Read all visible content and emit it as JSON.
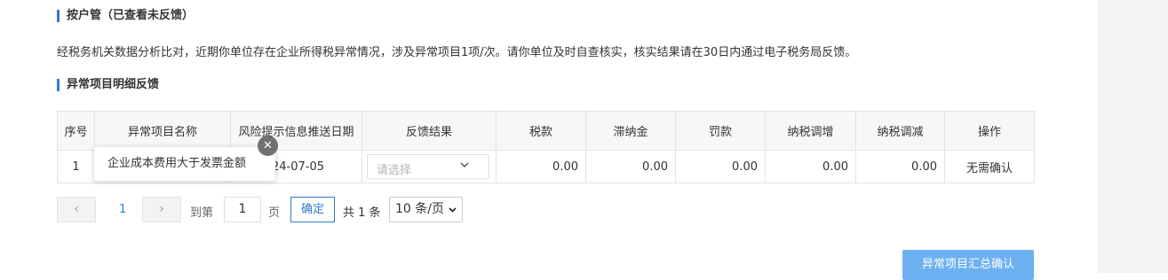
{
  "section1": {
    "title": "按户管（已查看未反馈）"
  },
  "notice": {
    "text": "经税务机关数据分析比对，近期你单位存在企业所得税异常情况，涉及异常项目1项/次。请你单位及时自查核实，核实结果请在30日内通过电子税务局反馈。"
  },
  "section2": {
    "title": "异常项目明细反馈"
  },
  "table": {
    "headers": [
      "序号",
      "异常项目名称",
      "风险提示信息推送日期",
      "反馈结果",
      "税款",
      "滞纳金",
      "罚款",
      "纳税调增",
      "纳税调减",
      "操作"
    ],
    "rows": [
      {
        "index": "1",
        "item_name": "企业成本费用大于发票金额",
        "push_date_visible": "24-07-05",
        "feedback_placeholder": "请选择",
        "tax": "0.00",
        "late_fee": "0.00",
        "penalty": "0.00",
        "adjust_increase": "0.00",
        "adjust_decrease": "0.00",
        "action": "无需确认"
      }
    ]
  },
  "tooltip": {
    "text": "企业成本费用大于发票金额",
    "close_glyph": "✕"
  },
  "pagination": {
    "prev_glyph": "‹",
    "current_page": "1",
    "next_glyph": "›",
    "goto_label": "到第",
    "goto_value": "1",
    "page_unit": "页",
    "confirm_label": "确定",
    "total_label": "共 1 条",
    "page_size": "10 条/页"
  },
  "footer": {
    "summary_confirm_label": "异常项目汇总确认"
  },
  "colors": {
    "accent": "#2f7dd1",
    "button": "#6db1f2",
    "gutter": "#f2f3f5"
  }
}
